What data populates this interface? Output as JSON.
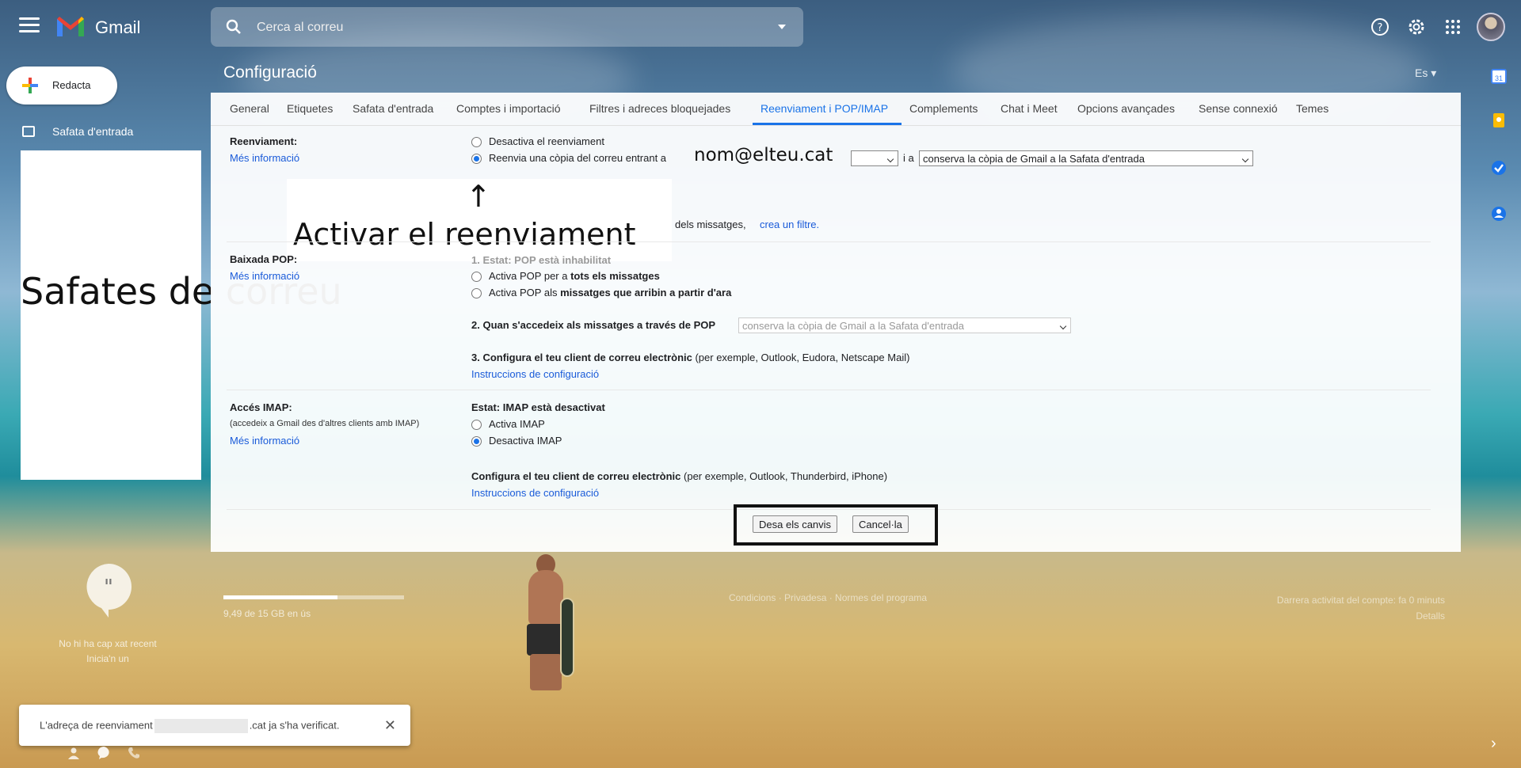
{
  "app": {
    "name": "Gmail"
  },
  "search": {
    "placeholder": "Cerca al correu"
  },
  "sidebar": {
    "compose_label": "Redacta",
    "inbox_label": "Safata d'entrada",
    "overlay_text": "Safates de correu",
    "chat_empty_line1": "No hi ha cap xat recent",
    "chat_empty_line2": "Inicia'n un",
    "storage_text": "9,49 de 15 GB en ús",
    "storage_fraction": 0.63
  },
  "settings": {
    "title": "Configuració",
    "lang": "Es",
    "tabs": [
      "General",
      "Etiquetes",
      "Safata d'entrada",
      "Comptes i importació",
      "Filtres i adreces bloquejades",
      "Reenviament i POP/IMAP",
      "Complements",
      "Chat i Meet",
      "Opcions avançades",
      "Sense connexió",
      "Temes"
    ],
    "active_tab": "Reenviament i POP/IMAP",
    "forwarding": {
      "label": "Reenviament:",
      "more_info": "Més informació",
      "option_disable": "Desactiva el reenviament",
      "option_forward": "Reenvia una còpia del correu entrant a",
      "email": "nom@elteu.cat",
      "and": "i a",
      "action_select": "conserva la còpia de Gmail a la Safata d'entrada",
      "filter_tail": "dels missatges,",
      "filter_link": "crea un filtre."
    },
    "callout": {
      "arrow": "↑",
      "text": "Activar el reenviament"
    },
    "pop": {
      "label": "Baixada POP:",
      "more_info": "Més informació",
      "status": "1. Estat: POP està inhabilitat",
      "opt_all_a": "Activa POP per a ",
      "opt_all_b": "tots els missatges",
      "opt_new_a": "Activa POP als ",
      "opt_new_b": "missatges que arribin a partir d'ara",
      "step2": "2. Quan s'accedeix als missatges a través de POP",
      "step2_select": "conserva la còpia de Gmail a la Safata d'entrada",
      "step3_bold": "3. Configura el teu client de correu electrònic",
      "step3_rest": " (per exemple, Outlook, Eudora, Netscape Mail)",
      "instructions": "Instruccions de configuració"
    },
    "imap": {
      "label": "Accés IMAP:",
      "sub": "(accedeix a Gmail des d'altres clients amb IMAP)",
      "more_info": "Més informació",
      "status": "Estat: IMAP està desactivat",
      "opt_enable": "Activa IMAP",
      "opt_disable": "Desactiva IMAP",
      "client_bold": "Configura el teu client de correu electrònic",
      "client_rest": " (per exemple, Outlook, Thunderbird, iPhone)",
      "instructions": "Instruccions de configuració"
    },
    "buttons": {
      "save": "Desa els canvis",
      "cancel": "Cancel·la"
    }
  },
  "footer": {
    "links": "Condicions · Privadesa · Normes del programa",
    "activity_line1": "Darrera activitat del compte: fa 0 minuts",
    "activity_line2": "Detalls"
  },
  "toast": {
    "text_a": "L'adreça de reenviament",
    "text_b": ".cat ja s'ha verificat.",
    "close": "✕"
  },
  "colors": {
    "accent": "#1a73e8",
    "link": "#1a5bd9"
  }
}
